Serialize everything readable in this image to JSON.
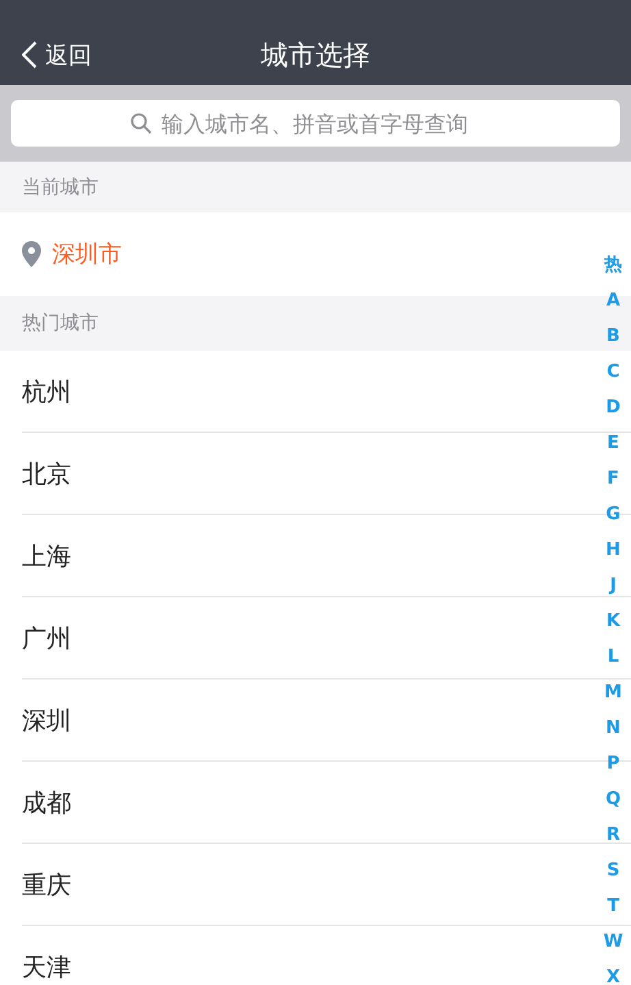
{
  "nav": {
    "back": "返回",
    "title": "城市选择"
  },
  "search": {
    "placeholder": "输入城市名、拼音或首字母查询"
  },
  "current_section": {
    "header": "当前城市",
    "city": "深圳市"
  },
  "hot_section": {
    "header": "热门城市",
    "cities": [
      "杭州",
      "北京",
      "上海",
      "广州",
      "深圳",
      "成都",
      "重庆",
      "天津"
    ]
  },
  "index": [
    "热",
    "A",
    "B",
    "C",
    "D",
    "E",
    "F",
    "G",
    "H",
    "J",
    "K",
    "L",
    "M",
    "N",
    "P",
    "Q",
    "R",
    "S",
    "T",
    "W",
    "X"
  ]
}
